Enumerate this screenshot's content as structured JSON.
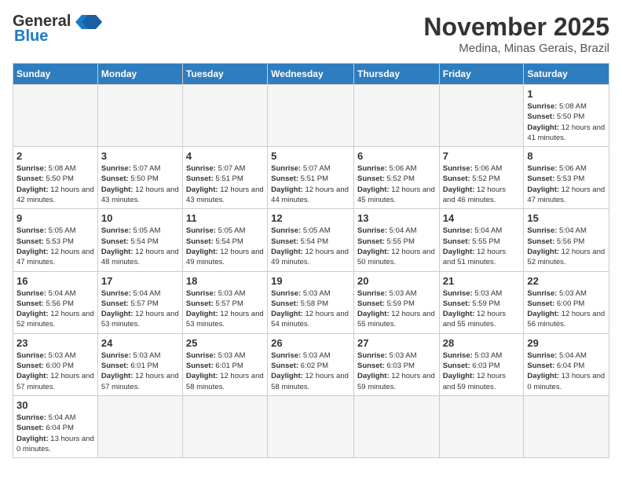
{
  "header": {
    "logo_general": "General",
    "logo_blue": "Blue",
    "month_title": "November 2025",
    "location": "Medina, Minas Gerais, Brazil"
  },
  "days_of_week": [
    "Sunday",
    "Monday",
    "Tuesday",
    "Wednesday",
    "Thursday",
    "Friday",
    "Saturday"
  ],
  "weeks": [
    [
      {
        "day": "",
        "info": ""
      },
      {
        "day": "",
        "info": ""
      },
      {
        "day": "",
        "info": ""
      },
      {
        "day": "",
        "info": ""
      },
      {
        "day": "",
        "info": ""
      },
      {
        "day": "",
        "info": ""
      },
      {
        "day": "1",
        "sunrise": "5:08 AM",
        "sunset": "5:50 PM",
        "daylight": "12 hours and 41 minutes."
      }
    ],
    [
      {
        "day": "2",
        "sunrise": "5:08 AM",
        "sunset": "5:50 PM",
        "daylight": "12 hours and 42 minutes."
      },
      {
        "day": "3",
        "sunrise": "5:07 AM",
        "sunset": "5:50 PM",
        "daylight": "12 hours and 43 minutes."
      },
      {
        "day": "4",
        "sunrise": "5:07 AM",
        "sunset": "5:51 PM",
        "daylight": "12 hours and 43 minutes."
      },
      {
        "day": "5",
        "sunrise": "5:07 AM",
        "sunset": "5:51 PM",
        "daylight": "12 hours and 44 minutes."
      },
      {
        "day": "6",
        "sunrise": "5:06 AM",
        "sunset": "5:52 PM",
        "daylight": "12 hours and 45 minutes."
      },
      {
        "day": "7",
        "sunrise": "5:06 AM",
        "sunset": "5:52 PM",
        "daylight": "12 hours and 46 minutes."
      },
      {
        "day": "8",
        "sunrise": "5:06 AM",
        "sunset": "5:53 PM",
        "daylight": "12 hours and 47 minutes."
      }
    ],
    [
      {
        "day": "9",
        "sunrise": "5:05 AM",
        "sunset": "5:53 PM",
        "daylight": "12 hours and 47 minutes."
      },
      {
        "day": "10",
        "sunrise": "5:05 AM",
        "sunset": "5:54 PM",
        "daylight": "12 hours and 48 minutes."
      },
      {
        "day": "11",
        "sunrise": "5:05 AM",
        "sunset": "5:54 PM",
        "daylight": "12 hours and 49 minutes."
      },
      {
        "day": "12",
        "sunrise": "5:05 AM",
        "sunset": "5:54 PM",
        "daylight": "12 hours and 49 minutes."
      },
      {
        "day": "13",
        "sunrise": "5:04 AM",
        "sunset": "5:55 PM",
        "daylight": "12 hours and 50 minutes."
      },
      {
        "day": "14",
        "sunrise": "5:04 AM",
        "sunset": "5:55 PM",
        "daylight": "12 hours and 51 minutes."
      },
      {
        "day": "15",
        "sunrise": "5:04 AM",
        "sunset": "5:56 PM",
        "daylight": "12 hours and 52 minutes."
      }
    ],
    [
      {
        "day": "16",
        "sunrise": "5:04 AM",
        "sunset": "5:56 PM",
        "daylight": "12 hours and 52 minutes."
      },
      {
        "day": "17",
        "sunrise": "5:04 AM",
        "sunset": "5:57 PM",
        "daylight": "12 hours and 53 minutes."
      },
      {
        "day": "18",
        "sunrise": "5:03 AM",
        "sunset": "5:57 PM",
        "daylight": "12 hours and 53 minutes."
      },
      {
        "day": "19",
        "sunrise": "5:03 AM",
        "sunset": "5:58 PM",
        "daylight": "12 hours and 54 minutes."
      },
      {
        "day": "20",
        "sunrise": "5:03 AM",
        "sunset": "5:59 PM",
        "daylight": "12 hours and 55 minutes."
      },
      {
        "day": "21",
        "sunrise": "5:03 AM",
        "sunset": "5:59 PM",
        "daylight": "12 hours and 55 minutes."
      },
      {
        "day": "22",
        "sunrise": "5:03 AM",
        "sunset": "6:00 PM",
        "daylight": "12 hours and 56 minutes."
      }
    ],
    [
      {
        "day": "23",
        "sunrise": "5:03 AM",
        "sunset": "6:00 PM",
        "daylight": "12 hours and 57 minutes."
      },
      {
        "day": "24",
        "sunrise": "5:03 AM",
        "sunset": "6:01 PM",
        "daylight": "12 hours and 57 minutes."
      },
      {
        "day": "25",
        "sunrise": "5:03 AM",
        "sunset": "6:01 PM",
        "daylight": "12 hours and 58 minutes."
      },
      {
        "day": "26",
        "sunrise": "5:03 AM",
        "sunset": "6:02 PM",
        "daylight": "12 hours and 58 minutes."
      },
      {
        "day": "27",
        "sunrise": "5:03 AM",
        "sunset": "6:03 PM",
        "daylight": "12 hours and 59 minutes."
      },
      {
        "day": "28",
        "sunrise": "5:03 AM",
        "sunset": "6:03 PM",
        "daylight": "12 hours and 59 minutes."
      },
      {
        "day": "29",
        "sunrise": "5:04 AM",
        "sunset": "6:04 PM",
        "daylight": "13 hours and 0 minutes."
      }
    ],
    [
      {
        "day": "30",
        "sunrise": "5:04 AM",
        "sunset": "6:04 PM",
        "daylight": "13 hours and 0 minutes."
      },
      {
        "day": "",
        "info": ""
      },
      {
        "day": "",
        "info": ""
      },
      {
        "day": "",
        "info": ""
      },
      {
        "day": "",
        "info": ""
      },
      {
        "day": "",
        "info": ""
      },
      {
        "day": "",
        "info": ""
      }
    ]
  ],
  "labels": {
    "sunrise": "Sunrise:",
    "sunset": "Sunset:",
    "daylight": "Daylight:"
  }
}
